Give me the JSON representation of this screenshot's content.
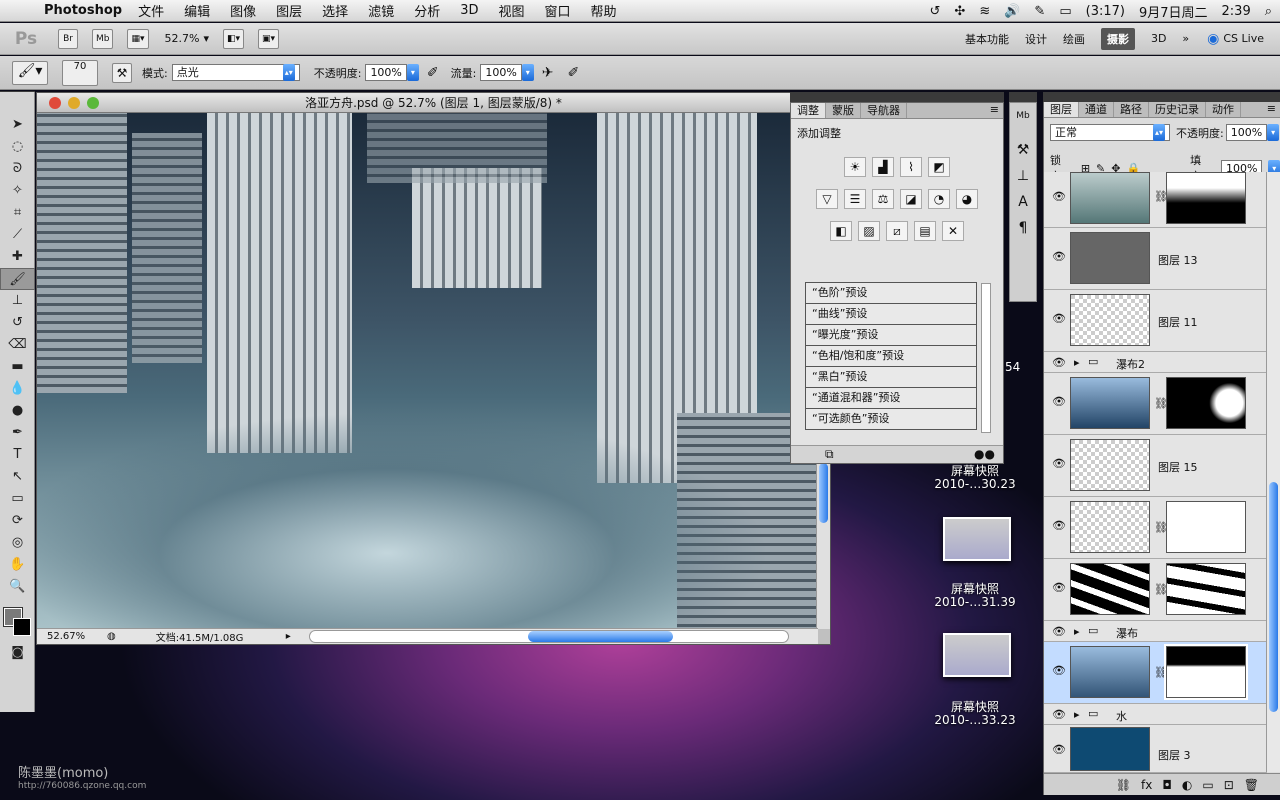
{
  "menubar": {
    "app": "Photoshop",
    "items": [
      "文件",
      "编辑",
      "图像",
      "图层",
      "选择",
      "滤镜",
      "分析",
      "3D",
      "视图",
      "窗口",
      "帮助"
    ],
    "battery": "(3:17)",
    "date": "9月7日周二",
    "time": "2:39"
  },
  "appbar": {
    "logo": "Ps",
    "br": "Br",
    "mb": "Mb",
    "zoom": "52.7%",
    "workspaces": [
      "基本功能",
      "设计",
      "绘画",
      "摄影",
      "3D"
    ],
    "active_ws": "摄影",
    "cslive": "CS Live"
  },
  "options": {
    "brush_size": "70",
    "mode_label": "模式:",
    "mode_value": "点光",
    "opacity_label": "不透明度:",
    "opacity_value": "100%",
    "flow_label": "流量:",
    "flow_value": "100%"
  },
  "document": {
    "title": "洛亚方舟.psd @ 52.7% (图层 1, 图层蒙版/8) *",
    "zoom": "52.67%",
    "file_info": "文档:41.5M/1.08G"
  },
  "adjustments": {
    "tabs": [
      "调整",
      "蒙版",
      "导航器"
    ],
    "heading": "添加调整",
    "presets": [
      "“色阶”预设",
      "“曲线”预设",
      "“曝光度”预设",
      "“色相/饱和度”预设",
      "“黑白”预设",
      "“通道混和器”预设",
      "“可选颜色”预设"
    ],
    "partial": "54"
  },
  "desktop": [
    {
      "label1": "屏幕快照",
      "label2": "2010-…30.23"
    },
    {
      "label1": "屏幕快照",
      "label2": "2010-…31.39"
    },
    {
      "label1": "屏幕快照",
      "label2": "2010-…33.23"
    }
  ],
  "layers": {
    "tabs": [
      "图层",
      "通道",
      "路径",
      "历史记录",
      "动作"
    ],
    "blend": "正常",
    "opacity_label": "不透明度:",
    "opacity": "100%",
    "lock_label": "锁定:",
    "fill_label": "填充:",
    "fill": "100%",
    "rows": [
      "",
      "图层 13",
      "图层 11",
      "瀑布2",
      "",
      "图层 15",
      "",
      "",
      "瀑布",
      "",
      "水",
      "图层 3"
    ]
  },
  "watermark": "陈墨墨(momo)",
  "watermark_url": "http://760086.qzone.qq.com",
  "colors": {
    "accent": "#2a7ae8",
    "layer_blue": "#0e4a72"
  }
}
